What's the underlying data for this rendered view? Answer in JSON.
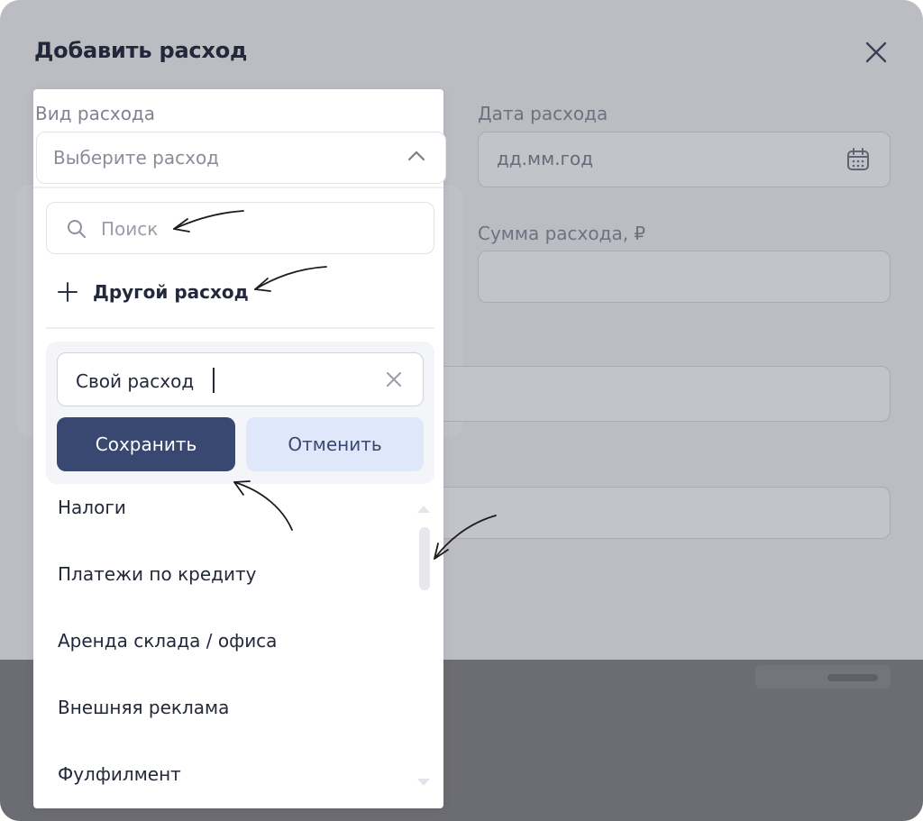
{
  "dialog": {
    "title": "Добавить расход",
    "close_icon": "close-icon"
  },
  "fields": {
    "expense_type": {
      "label": "Вид расхода",
      "placeholder": "Выберите расход",
      "chevron_icon": "chevron-up-icon"
    },
    "expense_date": {
      "label": "Дата расхода",
      "placeholder": "дд.мм.год",
      "icon": "calendar-icon"
    },
    "expense_amount": {
      "label": "Сумма расхода, ₽",
      "value": ""
    }
  },
  "dropdown": {
    "search": {
      "placeholder": "Поиск",
      "value": "",
      "icon": "search-icon"
    },
    "other_expense": {
      "label": "Другой расход",
      "icon": "plus-icon"
    },
    "custom_expense": {
      "value": "Свой расход",
      "clear_icon": "close-icon",
      "save_label": "Сохранить",
      "cancel_label": "Отменить"
    },
    "options": [
      "Налоги",
      "Платежи по кредиту",
      "Аренда склада / офиса",
      "Внешняя реклама",
      "Фулфилмент"
    ]
  },
  "colors": {
    "primary": "#394870",
    "secondary": "#dfe7fb",
    "overlay": "#bcbdc3",
    "text": "#23283a"
  }
}
